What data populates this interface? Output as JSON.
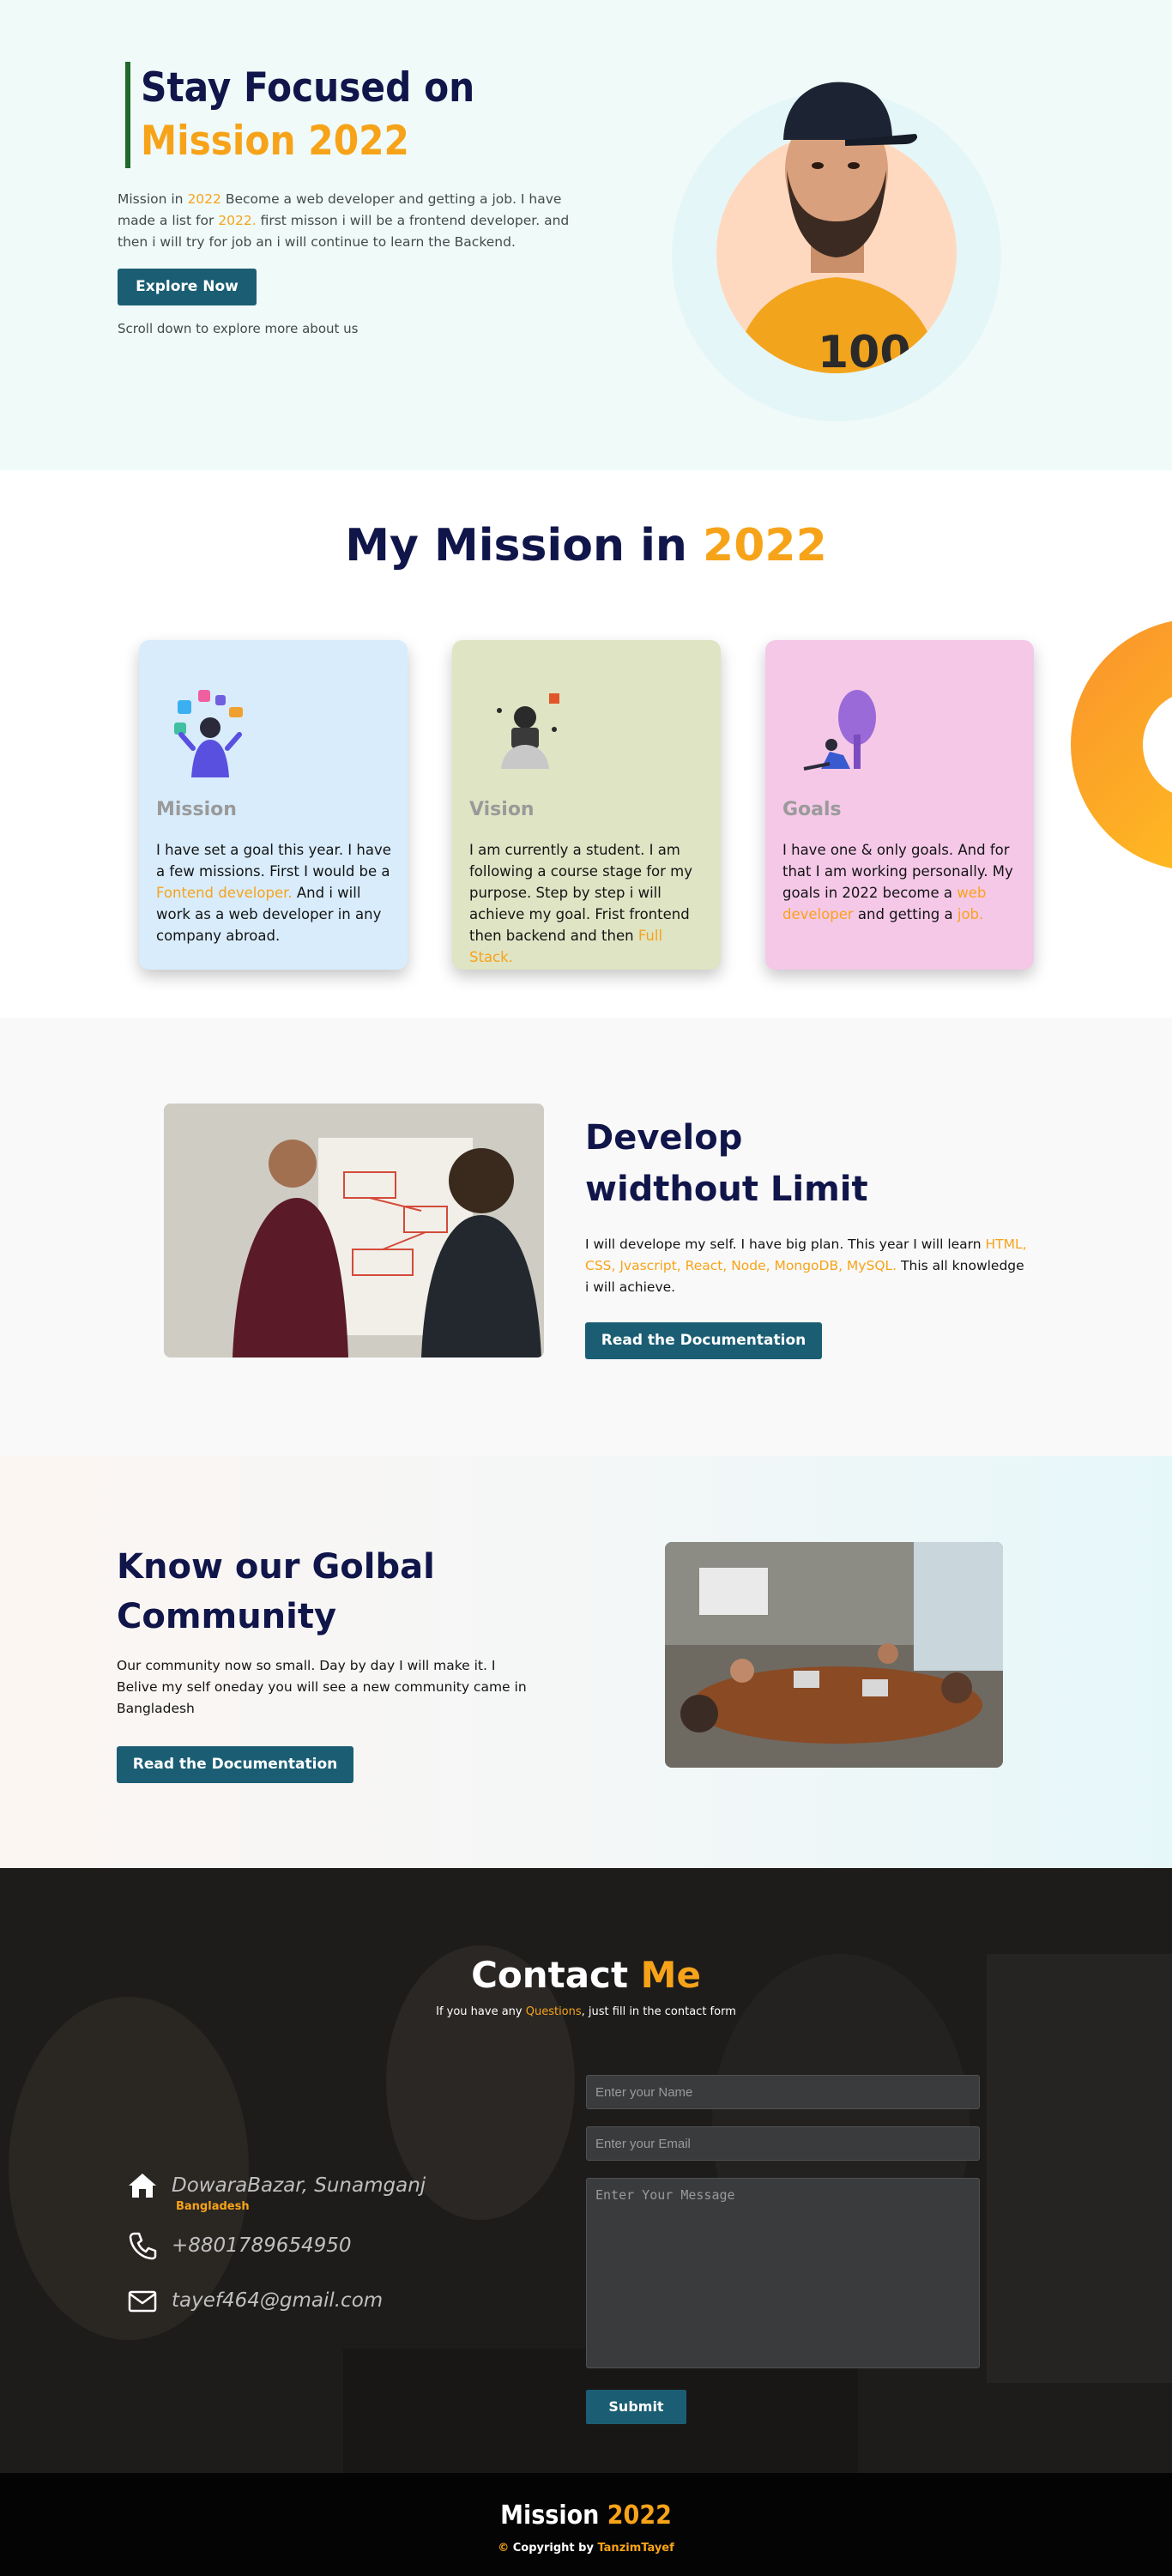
{
  "hero": {
    "title_line1": "Stay Focused on",
    "title_line2": "Mission 2022",
    "desc_part1": "Mission in ",
    "desc_year1": "2022",
    "desc_part2": " Become a web developer and getting a job. I have made a list for ",
    "desc_year2": "2022.",
    "desc_part3": " first misson i will be a frontend developer. and then i will try for job an i will continue to learn the Backend.",
    "button_label": "Explore Now",
    "scroll_note": "Scroll down to explore more about us"
  },
  "mission": {
    "title_main": "My Mission in ",
    "title_year": "2022",
    "cards": [
      {
        "title": "Mission",
        "text_before": "I have set a goal this year. I have a few missions. First I would be a ",
        "highlight": "Fontend developer.",
        "text_after": " And i will work as a web developer in any company abroad.",
        "bg": "#d8ecfc"
      },
      {
        "title": "Vision",
        "text_before": "I am currently a student. I am following a course stage for my purpose. Step by step i will achieve my goal. Frist frontend then backend and then ",
        "highlight": "Full Stack.",
        "text_after": "",
        "bg": "#dfe4c4"
      },
      {
        "title": "Goals",
        "text_before": "I have one & only goals. And for that I am working personally. My goals in 2022 become a ",
        "highlight": "web developer",
        "text_middle": " and getting a ",
        "highlight2": "job.",
        "bg": "#f5c8e8"
      }
    ]
  },
  "develop": {
    "title_line1": "Develop",
    "title_line2": "widthout Limit",
    "text_before": "I will develope my self. I have big plan. This year I will learn ",
    "highlight": "HTML, CSS, Jvascript, React, Node, MongoDB, MySQL.",
    "text_after": " This all knowledge i will achieve.",
    "button_label": "Read the Documentation"
  },
  "community": {
    "title_line1": "Know our Golbal",
    "title_line2": "Community",
    "text": "Our community now so small. Day by day I will make it. I Belive my self oneday you will see a new community came in Bangladesh",
    "button_label": "Read the Documentation"
  },
  "contact": {
    "title_main": "Contact ",
    "title_accent": "Me",
    "sub_before": "If you have any ",
    "sub_highlight": "Questions",
    "sub_after": ", just fill in the contact form",
    "name_placeholder": "Enter your Name",
    "email_placeholder": "Enter your Email",
    "message_placeholder": "Enter Your Message",
    "submit_label": "Submit",
    "address": "DowaraBazar, Sunamganj",
    "address_sub": "Bangladesh",
    "phone": "+8801789654950",
    "email": "tayef464@gmail.com"
  },
  "footer": {
    "title_main": "Mission ",
    "title_year": "2022",
    "copy_symbol": "©",
    "copy_text": " Copyright by ",
    "copy_name": "TanzimTayef"
  },
  "colors": {
    "accent": "#f7a319",
    "navy": "#10154a",
    "button": "#1b5e74",
    "hero_bg": "#effaf9"
  }
}
